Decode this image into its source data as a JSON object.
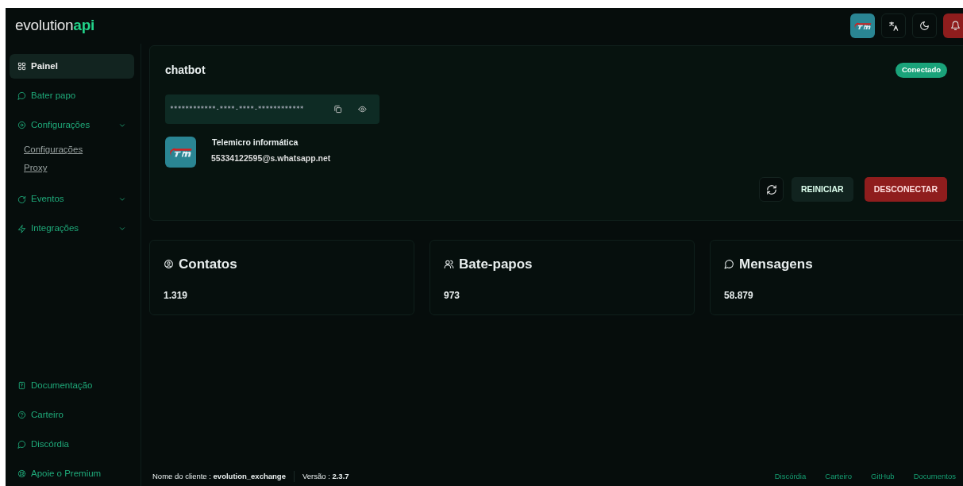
{
  "logo": {
    "text": "evolution",
    "accent": "api"
  },
  "header": {
    "buttons": [
      {
        "kind": "avatar"
      },
      {
        "kind": "translate"
      },
      {
        "kind": "theme"
      },
      {
        "kind": "bell"
      }
    ]
  },
  "sidebar": {
    "items": [
      {
        "label": "Painel",
        "kind": "link",
        "selected": true
      },
      {
        "label": "Bater papo",
        "kind": "link",
        "selected": false
      },
      {
        "label": "Configurações",
        "kind": "group",
        "selected": false,
        "children": [
          {
            "label": "Configurações"
          },
          {
            "label": "Proxy"
          }
        ]
      },
      {
        "label": "Eventos",
        "kind": "group",
        "selected": false
      },
      {
        "label": "Integrações",
        "kind": "group",
        "selected": false
      }
    ],
    "bottom": [
      {
        "label": "Documentação"
      },
      {
        "label": "Carteiro"
      },
      {
        "label": "Discórdia"
      },
      {
        "label": "Apoie o Premium"
      }
    ]
  },
  "instance": {
    "name": "chatbot",
    "status": "Conectado",
    "connected": true,
    "token": "************-****-****-************",
    "profile_name": "Telemicro informática",
    "profile_id": "55334122595@s.whatsapp.net",
    "buttons": [
      "REINICIAR",
      "DESCONECTAR"
    ]
  },
  "stats": [
    {
      "title": "Contatos",
      "value": "1.319"
    },
    {
      "title": "Bate-papos",
      "value": "973"
    },
    {
      "title": "Mensagens",
      "value": "58.879"
    }
  ],
  "footer": {
    "client_label": "Nome do cliente :",
    "client": "evolution_exchange",
    "version_label": "Versão :",
    "version": "2.3.7",
    "links": [
      "Discórdia",
      "Carteiro",
      "GitHub",
      "Documentos"
    ]
  }
}
